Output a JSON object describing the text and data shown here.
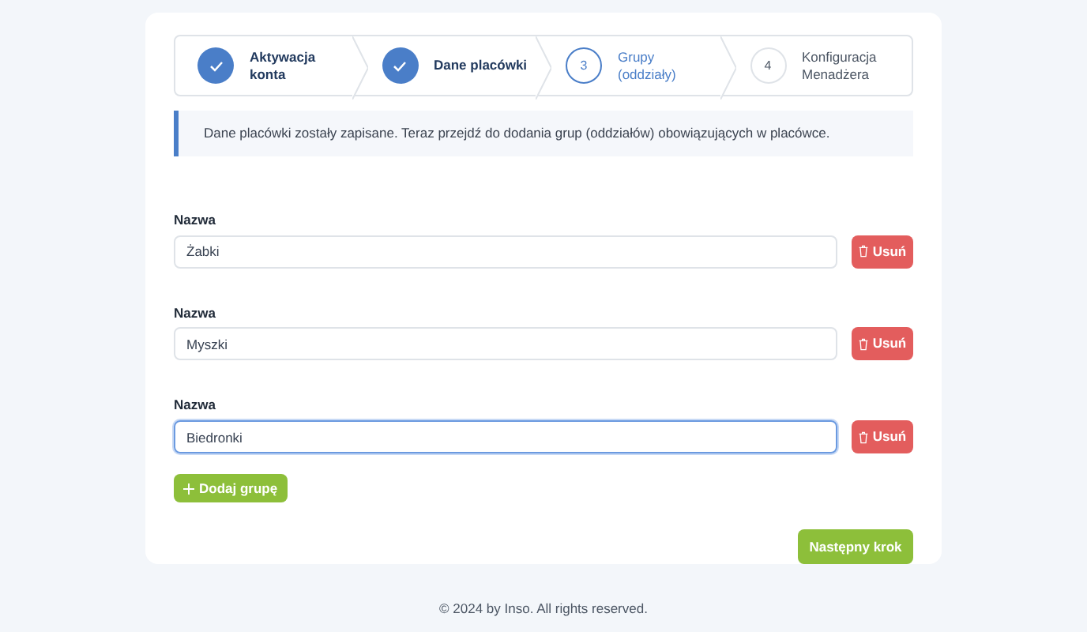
{
  "steps": [
    {
      "label": "Aktywacja konta",
      "completed": true,
      "selected": false
    },
    {
      "label": "Dane placówki",
      "completed": true,
      "selected": false
    },
    {
      "number": "3",
      "label": "Grupy (oddziały)",
      "completed": false,
      "selected": true
    },
    {
      "number": "4",
      "label": "Konfiguracja Menadżera",
      "completed": false,
      "selected": false
    }
  ],
  "alert": "Dane placówki zostały zapisane. Teraz przejdź do dodania grup (oddziałów) obowiązujących w placówce.",
  "groups": [
    {
      "label": "Nazwa",
      "value": "Żabki",
      "focused": false,
      "remove_button": "Usuń"
    },
    {
      "label": "Nazwa",
      "value": "Myszki",
      "focused": false,
      "remove_button": "Usuń"
    },
    {
      "label": "Nazwa",
      "value": "Biedronki",
      "focused": true,
      "remove_button": "Usuń"
    }
  ],
  "add_button": "Dodaj grupę",
  "next_button": "Następny krok",
  "footer": "© 2024 by Inso. All rights reserved."
}
